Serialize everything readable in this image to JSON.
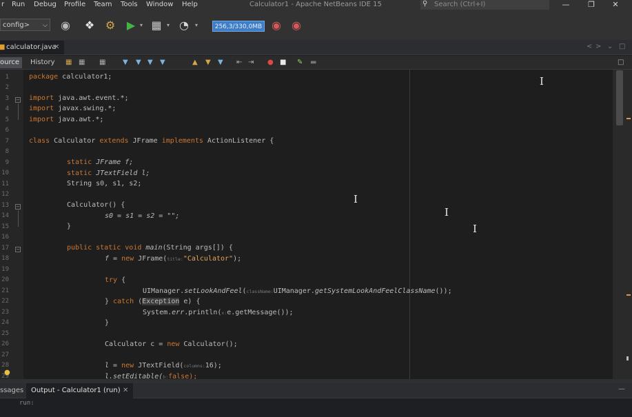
{
  "menu": [
    "r",
    "Run",
    "Debug",
    "Profile",
    "Team",
    "Tools",
    "Window",
    "Help"
  ],
  "window_title": "Calculator1 - Apache NetBeans IDE 15",
  "search": {
    "placeholder": "Search (Ctrl+I)"
  },
  "window_buttons": {
    "minimize": "—",
    "restore": "❐",
    "close": "✕"
  },
  "toolbar": {
    "config": "config>",
    "memory": "256,3/330,0MB",
    "icons": [
      "globe-icon",
      "hammer-icon",
      "clean-build-icon",
      "run-icon",
      "debug-icon",
      "profile-icon",
      "gc-icon",
      "profile-snapshot-icon"
    ]
  },
  "file_tab": {
    "name": "calculator.java",
    "close": "✕"
  },
  "editor_toolbar": {
    "source": "ource",
    "history": "History"
  },
  "line_numbers": [
    "1",
    "2",
    "3",
    "4",
    "5",
    "6",
    "7",
    "8",
    "9",
    "10",
    "11",
    "12",
    "13",
    "14",
    "15",
    "16",
    "17",
    "18",
    "19",
    "20",
    "21",
    "22",
    "23",
    "24",
    "25",
    "26",
    "27",
    "28",
    "29"
  ],
  "code": {
    "l1": [
      "package",
      " calculator1;"
    ],
    "l3": [
      "import",
      " java.awt.event.*;"
    ],
    "l4": [
      "import",
      " javax.swing.*;"
    ],
    "l5": [
      "import",
      " java.awt.*;"
    ],
    "l7": [
      "class",
      " Calculator ",
      "extends",
      " JFrame ",
      "implements",
      " ActionListener {"
    ],
    "l9": [
      "static",
      " JFrame f;"
    ],
    "l10": [
      "static",
      " JTextField l;"
    ],
    "l11": [
      "String s0, s1, s2;"
    ],
    "l13": [
      "Calculator() {"
    ],
    "l14": [
      "s0 = s1 = s2 = \"\";"
    ],
    "l15": [
      "}"
    ],
    "l17": [
      "public static void",
      " main",
      "(String args[]) {"
    ],
    "l18": [
      "f = ",
      "new",
      " JFrame(",
      "title:",
      "\"Calculator\"",
      ");"
    ],
    "l20": [
      "try",
      " {"
    ],
    "l21": [
      "UIManager.",
      "setLookAndFeel",
      "(",
      "className:",
      "UIManager.",
      "getSystemLookAndFeelClassName",
      "());"
    ],
    "l22": [
      "} ",
      "catch",
      " (",
      "Exception",
      " e) {"
    ],
    "l23": [
      "System.",
      "err",
      ".println(",
      "x:",
      "e.getMessage());"
    ],
    "l24": [
      "}"
    ],
    "l26": [
      "Calculator c = ",
      "new",
      " Calculator();"
    ],
    "l28": [
      "l = ",
      "new",
      " JTextField(",
      "columns:",
      "16);"
    ],
    "l29": [
      "l.setEditable(",
      "b:",
      "false);"
    ]
  },
  "output": {
    "tab_messages": "ssages",
    "tab_run": "Output - Calculator1 (run)",
    "close": "✕",
    "minimize": "—",
    "text": "run:"
  },
  "colors": {
    "keyword": "#cc7832",
    "string": "#e4a45c",
    "memory_bar": "#3e7dc7",
    "background": "#1e1e1e"
  }
}
